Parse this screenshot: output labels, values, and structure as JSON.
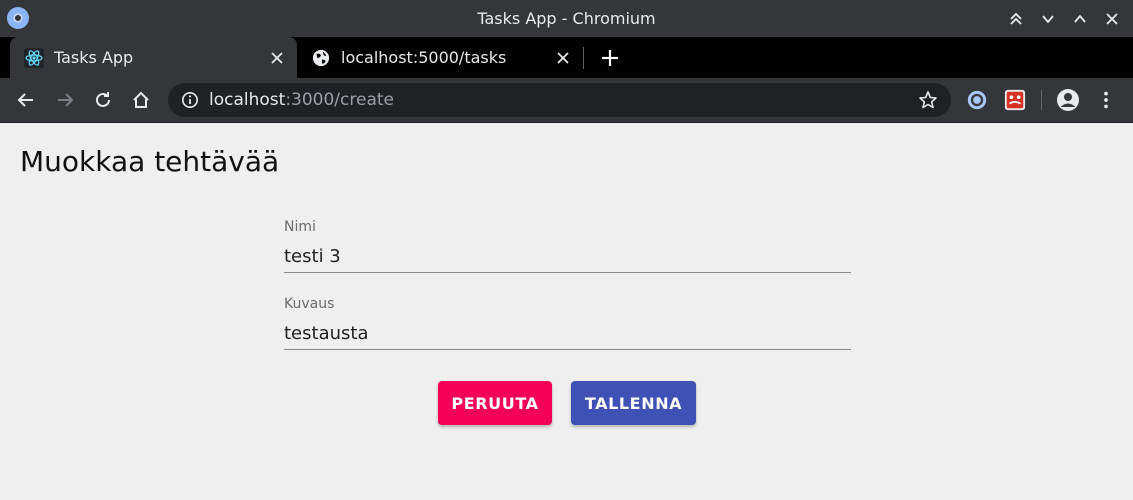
{
  "window": {
    "title": "Tasks App - Chromium"
  },
  "tabs": [
    {
      "label": "Tasks App",
      "active": true
    },
    {
      "label": "localhost:5000/tasks",
      "active": false
    }
  ],
  "omnibox": {
    "host": "localhost",
    "path": ":3000/create"
  },
  "page": {
    "title": "Muokkaa tehtävää",
    "fields": {
      "name": {
        "label": "Nimi",
        "value": "testi 3"
      },
      "description": {
        "label": "Kuvaus",
        "value": "testausta"
      }
    },
    "buttons": {
      "cancel": "PERUUTA",
      "save": "TALLENNA"
    }
  },
  "colors": {
    "cancel": "#f50057",
    "save": "#3f51b5",
    "background": "#efefef"
  },
  "icons": [
    "chromium-logo-icon",
    "react-icon",
    "globe-icon",
    "back-icon",
    "forward-icon",
    "reload-icon",
    "home-icon",
    "info-icon",
    "star-icon",
    "extension-icon",
    "profile-icon",
    "menu-icon"
  ]
}
